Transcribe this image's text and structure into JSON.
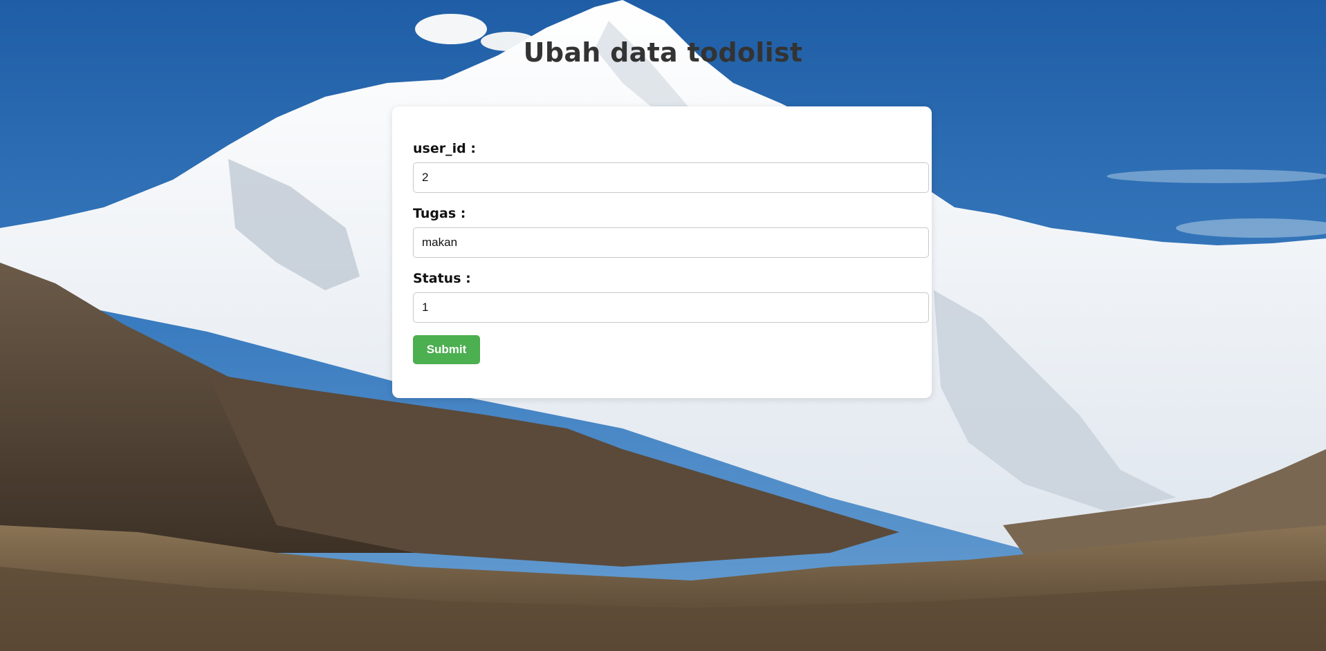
{
  "page": {
    "title": "Ubah data todolist"
  },
  "form": {
    "fields": [
      {
        "label": "user_id :",
        "value": "2"
      },
      {
        "label": "Tugas :",
        "value": "makan"
      },
      {
        "label": "Status :",
        "value": "1"
      }
    ],
    "submit_label": "Submit"
  },
  "colors": {
    "submit_button": "#4caf50",
    "title_text": "#333333",
    "card_background": "#ffffff"
  }
}
